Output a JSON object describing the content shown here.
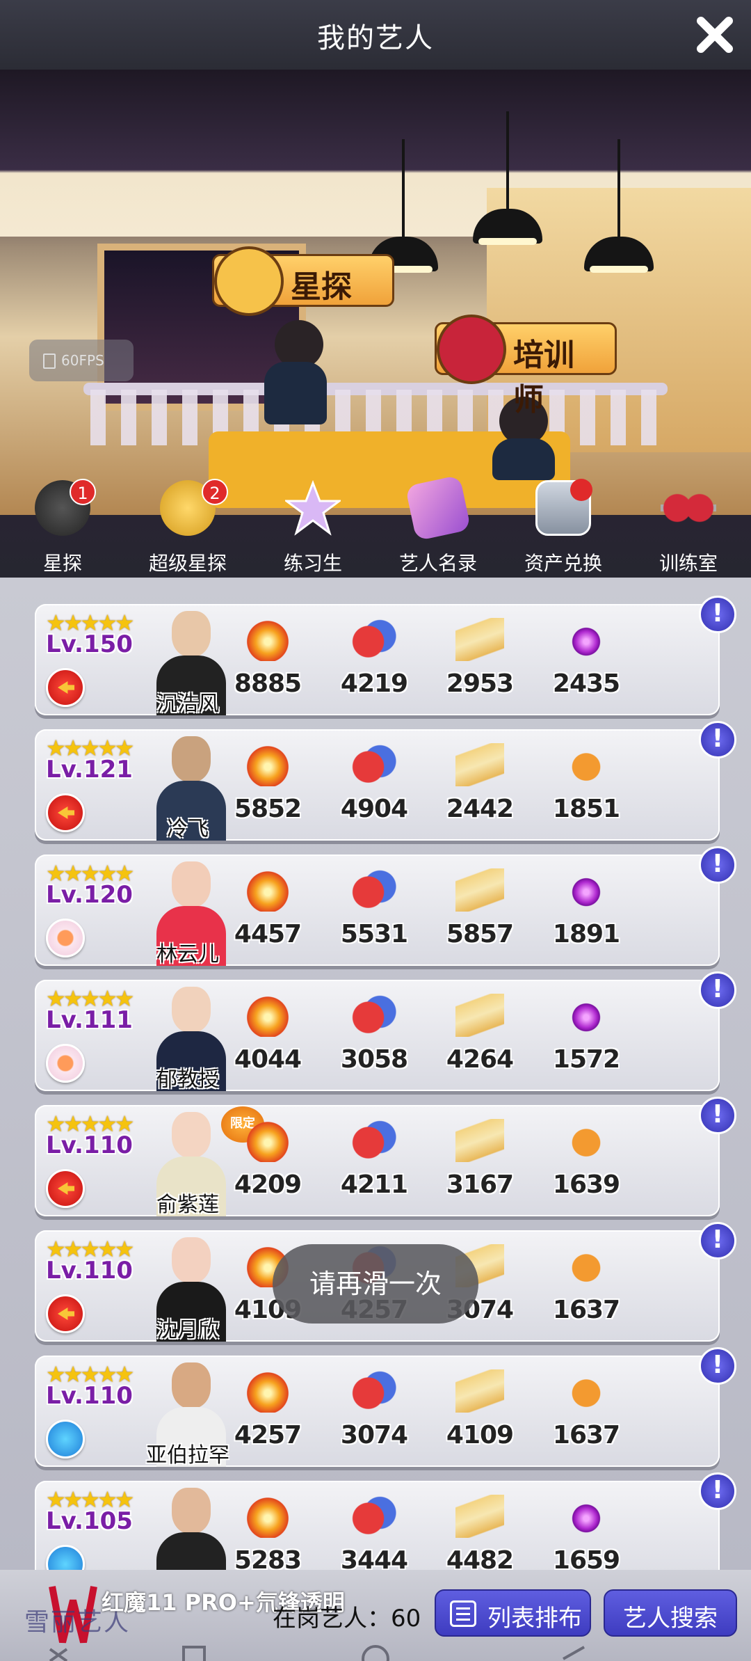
{
  "header": {
    "title": "我的艺人"
  },
  "scene": {
    "tags": [
      {
        "id": "scout",
        "label": "星探"
      },
      {
        "id": "trainer",
        "label": "培训师"
      }
    ],
    "fps": "60FPS"
  },
  "tabs": [
    {
      "label": "星探",
      "badge": "1",
      "icon": "question-hat-icon"
    },
    {
      "label": "超级星探",
      "badge": "2",
      "icon": "gold-hat-icon"
    },
    {
      "label": "练习生",
      "badge": "",
      "icon": "star-icon"
    },
    {
      "label": "艺人名录",
      "badge": "",
      "icon": "magazine-icon"
    },
    {
      "label": "资产兑换",
      "badge": "",
      "icon": "portrait-icon"
    },
    {
      "label": "训练室",
      "badge": "",
      "icon": "dumbbell-icon"
    }
  ],
  "stat_icons": [
    "explosion-icon",
    "drama-mask-icon",
    "book-icon",
    "disco-ball-icon",
    "palette-icon"
  ],
  "artists": [
    {
      "name": "沉浩风",
      "level": "Lv.150",
      "stars": "★★★★★",
      "badge": "red",
      "limited": "",
      "stats": [
        "8885",
        "4219",
        "2953",
        "2435"
      ],
      "last_icon": "disco-ball-icon"
    },
    {
      "name": "冷飞",
      "level": "Lv.121",
      "stars": "★★★★★",
      "badge": "red",
      "limited": "",
      "stats": [
        "5852",
        "4904",
        "2442",
        "1851"
      ],
      "last_icon": "palette-icon"
    },
    {
      "name": "林云儿",
      "level": "Lv.120",
      "stars": "★★★★★",
      "badge": "flower",
      "limited": "",
      "stats": [
        "4457",
        "5531",
        "5857",
        "1891"
      ],
      "last_icon": "disco-ball-icon"
    },
    {
      "name": "郁教授",
      "level": "Lv.111",
      "stars": "★★★★★",
      "badge": "flower",
      "limited": "",
      "stats": [
        "4044",
        "3058",
        "4264",
        "1572"
      ],
      "last_icon": "disco-ball-icon"
    },
    {
      "name": "俞紫莲",
      "level": "Lv.110",
      "stars": "★★★★★",
      "badge": "red",
      "limited": "限定",
      "stats": [
        "4209",
        "4211",
        "3167",
        "1639"
      ],
      "last_icon": "palette-icon"
    },
    {
      "name": "沈月欣",
      "level": "Lv.110",
      "stars": "★★★★★",
      "badge": "red",
      "limited": "",
      "stats": [
        "4109",
        "4257",
        "3074",
        "1637"
      ],
      "last_icon": "palette-icon"
    },
    {
      "name": "亚伯拉罕",
      "level": "Lv.110",
      "stars": "★★★★★",
      "badge": "blue",
      "limited": "",
      "stats": [
        "4257",
        "3074",
        "4109",
        "1637"
      ],
      "last_icon": "palette-icon"
    },
    {
      "name": "",
      "level": "Lv.105",
      "stars": "★★★★★",
      "badge": "blue",
      "limited": "",
      "stats": [
        "5283",
        "3444",
        "4482",
        "1659"
      ],
      "last_icon": "disco-ball-icon"
    }
  ],
  "toast": "请再滑一次",
  "bottom": {
    "logo_text": "雪丽艺人",
    "watermark": "红魔11 PRO+氘锋透明",
    "count_label": "在岗艺人：",
    "count_value": "60",
    "sort_button": "列表排布",
    "search_button": "艺人搜索"
  },
  "colors": {
    "accent": "#4b49d0",
    "level_text": "#7a1ea6",
    "star": "#f5c30f",
    "alert": "#3f3dc0"
  }
}
